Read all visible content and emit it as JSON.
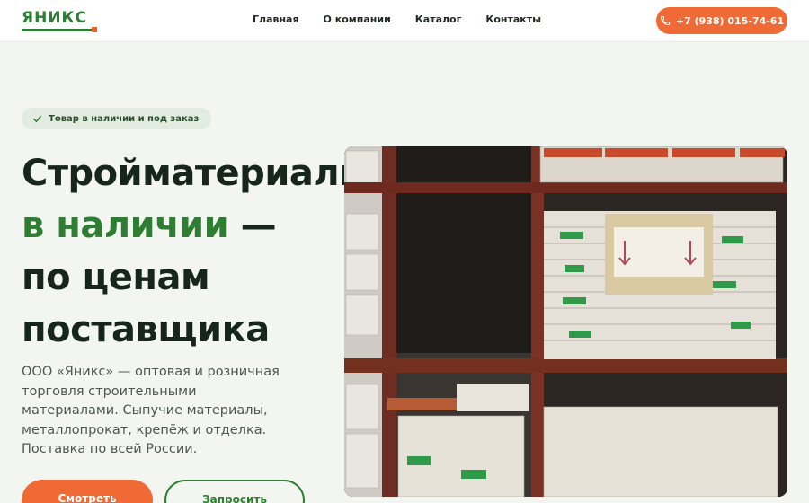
{
  "header": {
    "logo": "ЯНИКС",
    "nav": [
      "Главная",
      "О компании",
      "Каталог",
      "Контакты"
    ],
    "phone": "+7 (938) 015-74-61"
  },
  "hero": {
    "badge": "Товар в наличии и под заказ",
    "headline_1": "Стройматериалы",
    "headline_2": "в наличии",
    "headline_2b": " —",
    "headline_3": "по ценам",
    "headline_4": "поставщика",
    "description": "ООО «Яникс» — оптовая и розничная торговля строительными материалами. Сыпучие материалы, металлопрокат, крепёж и отделка. Поставка по всей России.",
    "cta_primary": "Смотреть",
    "cta_secondary": "Запросить"
  },
  "colors": {
    "brand_green": "#2f7d32",
    "accent_orange": "#ef6a35",
    "background": "#f3f5f1"
  }
}
